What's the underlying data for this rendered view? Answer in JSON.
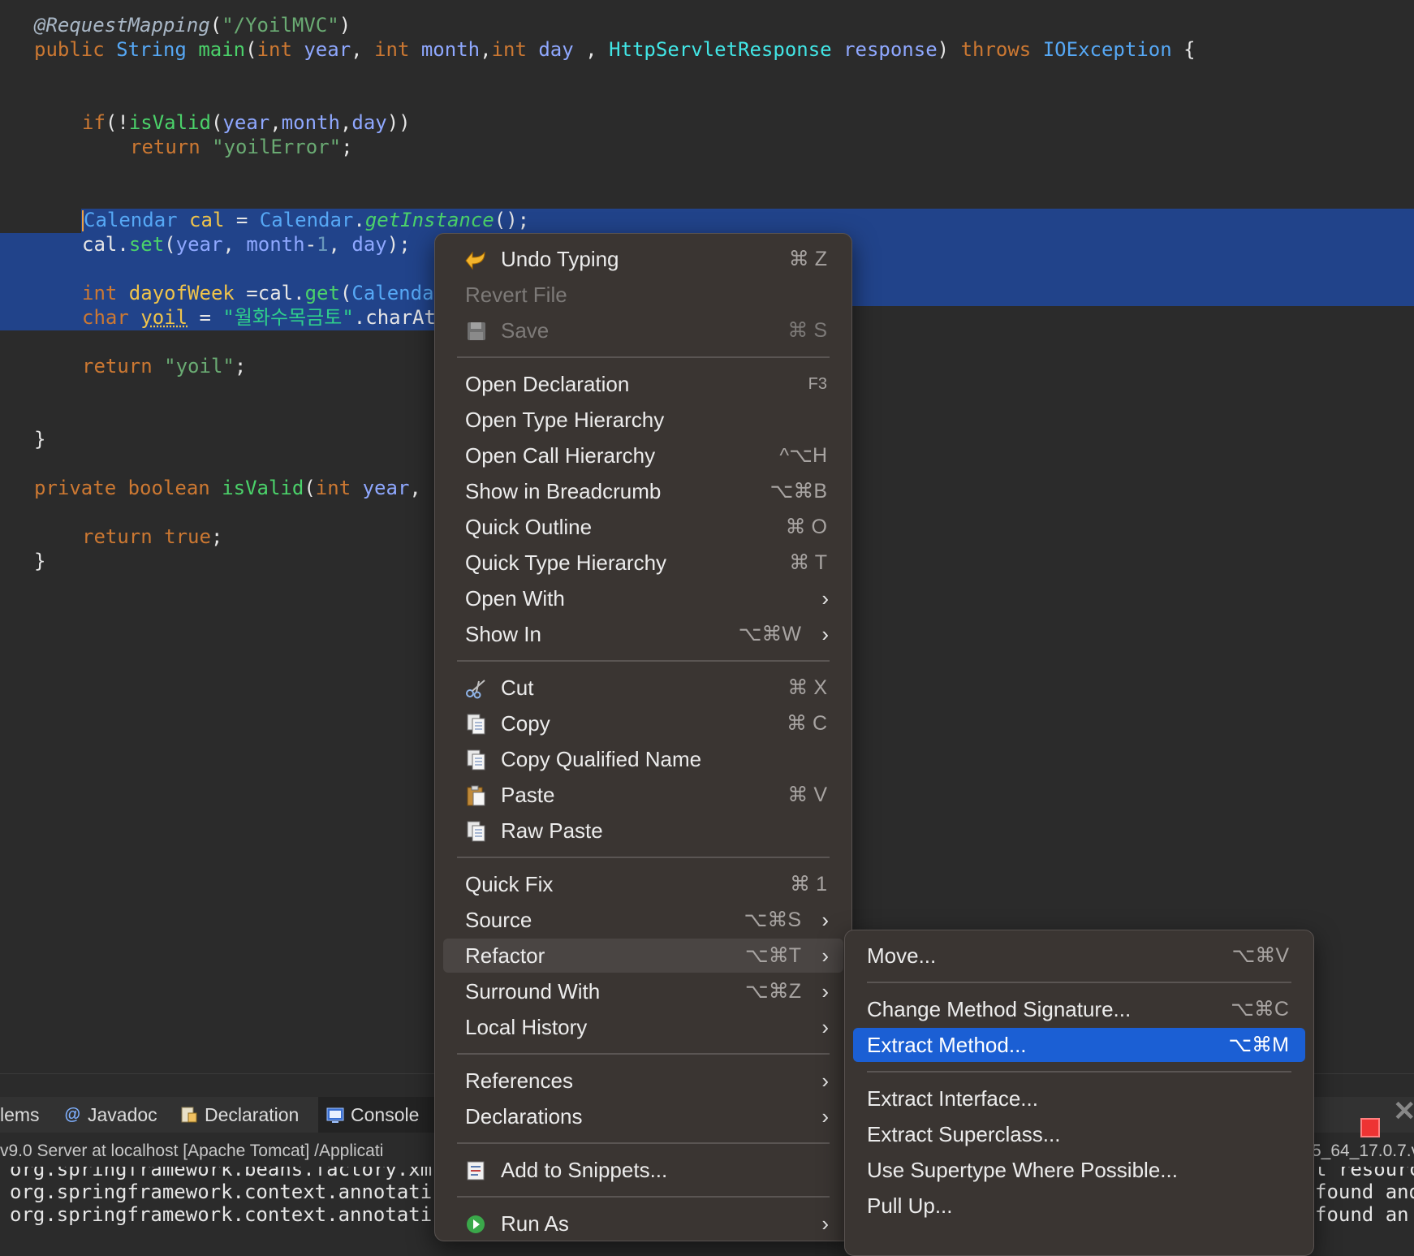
{
  "editor": {
    "lines": {
      "l1_ann": "@RequestMapping",
      "l1_open": "(",
      "l1_str": "\"/YoilMVC\"",
      "l1_close": ")",
      "l2_public": "public ",
      "l2_string": "String ",
      "l2_main": "main",
      "l2_open": "(",
      "l2_int1": "int ",
      "l2_year": "year",
      "l2_comma1": ", ",
      "l2_int2": "int ",
      "l2_month": "month",
      "l2_comma2": ",",
      "l2_int3": "int ",
      "l2_day": "day",
      "l2_comma3": " , ",
      "l2_resp_type": "HttpServletResponse ",
      "l2_resp": "response",
      "l2_close": ") ",
      "l2_throws": "throws ",
      "l2_ioex": "IOException",
      "l2_brace": " {",
      "l5_if": "if",
      "l5_open": "(!",
      "l5_isvalid": "isValid",
      "l5_open2": "(",
      "l5_year": "year",
      "l5_c1": ",",
      "l5_month": "month",
      "l5_c2": ",",
      "l5_day": "day",
      "l5_close": "))",
      "l6_return": "return ",
      "l6_str": "\"yoilError\"",
      "l6_semi": ";",
      "l9_type": "Calendar ",
      "l9_cal": "cal",
      "l9_eq": " = ",
      "l9_type2": "Calendar",
      "l9_dot": ".",
      "l9_getinst": "getInstance",
      "l9_end": "();",
      "l10_cal": "cal",
      "l10_dot": ".",
      "l10_set": "set",
      "l10_open": "(",
      "l10_year": "year",
      "l10_c1": ", ",
      "l10_month": "month",
      "l10_minus": "-",
      "l10_one": "1",
      "l10_c2": ", ",
      "l10_day": "day",
      "l10_end": ");",
      "l12_int": "int ",
      "l12_var": "dayofWeek",
      "l12_eq": " =",
      "l12_cal": "cal",
      "l12_dot": ".",
      "l12_get": "get",
      "l12_open": "(",
      "l12_trunc": "Calenda",
      "l13_char": "char ",
      "l13_yoil": "yoil",
      "l13_eq": " = ",
      "l13_str": "\"월화수목금토\"",
      "l13_charat": ".charAt",
      "l15_return": "return ",
      "l15_str": "\"yoil\"",
      "l15_semi": ";",
      "l18_brace": "}",
      "l20_private": "private ",
      "l20_boolean": "boolean ",
      "l20_isvalid": "isValid",
      "l20_open": "(",
      "l20_int": "int ",
      "l20_year": "year",
      "l20_comma": ",",
      "l22_return": "return ",
      "l22_true": "true",
      "l22_semi": ";",
      "l23_brace": "}"
    }
  },
  "bottom_panel": {
    "tabs": {
      "problems": "lems",
      "javadoc": "Javadoc",
      "declaration": "Declaration",
      "console": "Console"
    },
    "console_status": "v9.0 Server at localhost [Apache Tomcat] /Applicati",
    "console_status_right": "5_64_17.0.7.v",
    "console_lines": {
      "line1": "org.springframework.beans.factory.xml",
      "line2": "org.springframework.context.annotati",
      "line3": "org.springframework.context.annotati",
      "right1": "t resourc",
      "right2": "found and",
      "right3": "found an"
    }
  },
  "context_menu": {
    "undo_typing": {
      "label": "Undo Typing",
      "shortcut": "⌘ Z"
    },
    "revert_file": {
      "label": "Revert File"
    },
    "save": {
      "label": "Save",
      "shortcut": "⌘ S"
    },
    "open_declaration": {
      "label": "Open Declaration",
      "shortcut": "F3"
    },
    "open_type_hierarchy": {
      "label": "Open Type Hierarchy"
    },
    "open_call_hierarchy": {
      "label": "Open Call Hierarchy",
      "shortcut": "^⌥H"
    },
    "show_in_breadcrumb": {
      "label": "Show in Breadcrumb",
      "shortcut": "⌥⌘B"
    },
    "quick_outline": {
      "label": "Quick Outline",
      "shortcut": "⌘ O"
    },
    "quick_type_hierarchy": {
      "label": "Quick Type Hierarchy",
      "shortcut": "⌘ T"
    },
    "open_with": {
      "label": "Open With"
    },
    "show_in": {
      "label": "Show In",
      "shortcut": "⌥⌘W"
    },
    "cut": {
      "label": "Cut",
      "shortcut": "⌘ X"
    },
    "copy": {
      "label": "Copy",
      "shortcut": "⌘ C"
    },
    "copy_qualified_name": {
      "label": "Copy Qualified Name"
    },
    "paste": {
      "label": "Paste",
      "shortcut": "⌘ V"
    },
    "raw_paste": {
      "label": "Raw Paste"
    },
    "quick_fix": {
      "label": "Quick Fix",
      "shortcut": "⌘ 1"
    },
    "source": {
      "label": "Source",
      "shortcut": "⌥⌘S"
    },
    "refactor": {
      "label": "Refactor",
      "shortcut": "⌥⌘T"
    },
    "surround_with": {
      "label": "Surround With",
      "shortcut": "⌥⌘Z"
    },
    "local_history": {
      "label": "Local History"
    },
    "references": {
      "label": "References"
    },
    "declarations": {
      "label": "Declarations"
    },
    "add_to_snippets": {
      "label": "Add to Snippets..."
    },
    "run_as": {
      "label": "Run As"
    }
  },
  "refactor_submenu": {
    "move": {
      "label": "Move...",
      "shortcut": "⌥⌘V"
    },
    "change_method_signature": {
      "label": "Change Method Signature...",
      "shortcut": "⌥⌘C"
    },
    "extract_method": {
      "label": "Extract Method...",
      "shortcut": "⌥⌘M"
    },
    "extract_interface": {
      "label": "Extract Interface..."
    },
    "extract_superclass": {
      "label": "Extract Superclass..."
    },
    "use_supertype": {
      "label": "Use Supertype Where Possible..."
    },
    "pull_up": {
      "label": "Pull Up..."
    }
  },
  "colors": {
    "editor_bg": "#2b2b2b",
    "selection": "#21438a",
    "menu_bg": "#3a3532",
    "menu_selected": "#1b5fd4",
    "stop_red": "#e33333"
  },
  "icons": {
    "undo": "undo-arrow-icon",
    "save": "floppy-disk-icon",
    "cut": "scissors-icon",
    "copy": "copy-icon",
    "paste": "clipboard-icon",
    "snippets": "snippets-icon",
    "run_as": "run-icon"
  }
}
